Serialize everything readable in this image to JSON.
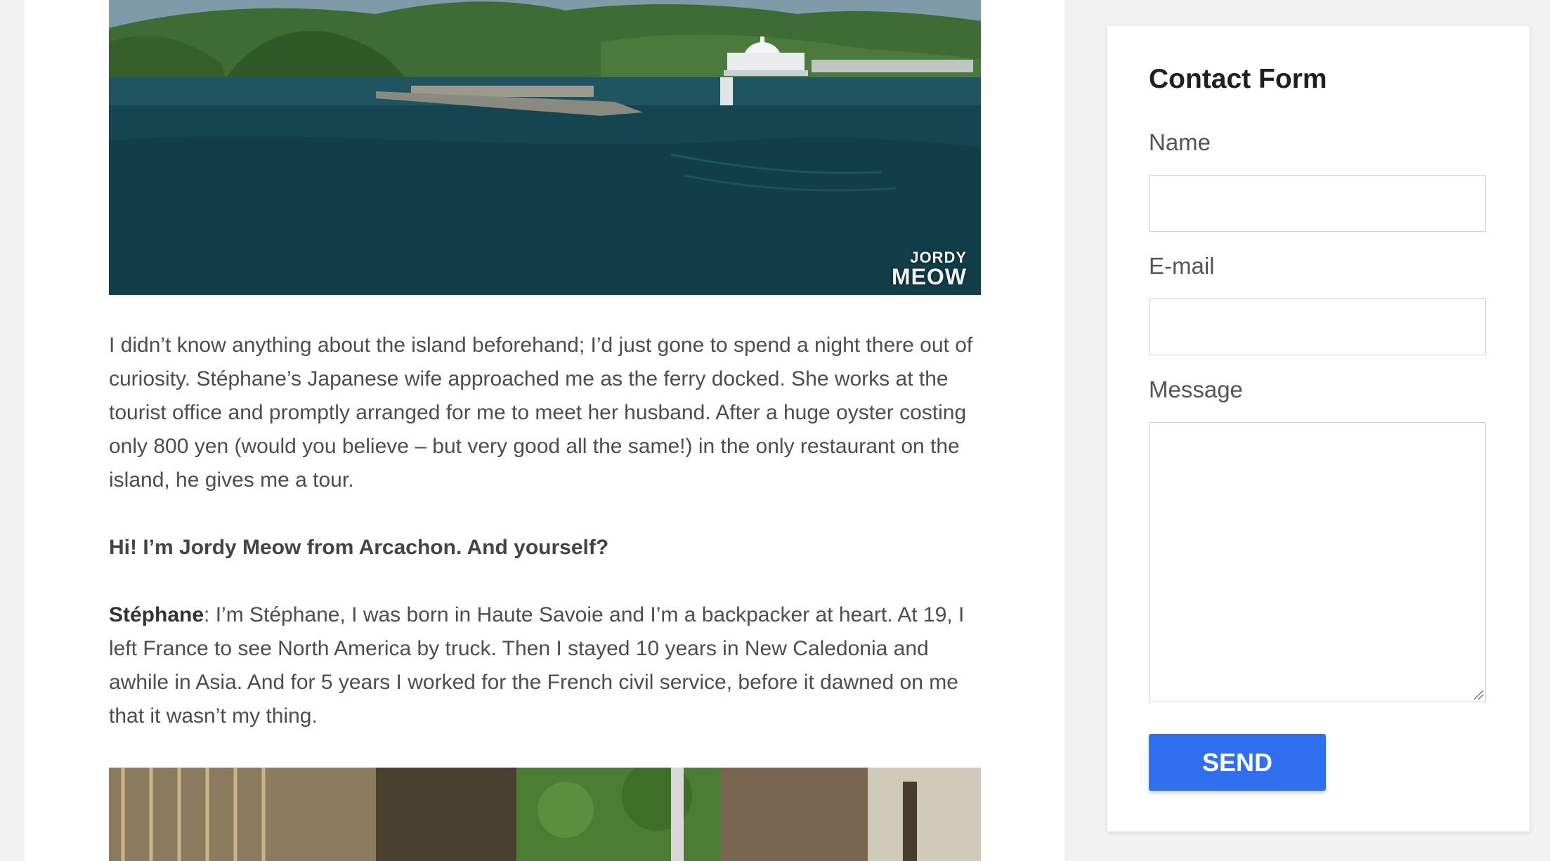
{
  "article": {
    "photo_top": {
      "watermark_line1": "JORDY",
      "watermark_line2": "MEOW"
    },
    "paragraph1": "I didn’t know anything about the island beforehand; I’d just gone to spend a night there out of curiosity. Stéphane’s Japanese wife approached me as the ferry docked. She works at the tourist office and promptly arranged for me to meet her husband. After a huge oyster costing only 800 yen (would you believe – but very good all the same!) in the only restaurant on the island, he gives me a tour.",
    "question": "Hi! I’m Jordy Meow from Arcachon. And yourself?",
    "answer_speaker": "Stéphane",
    "answer_text": ": I’m Stéphane, I was born in Haute Savoie and I’m a backpacker at heart. At 19, I left France to see North America by truck. Then I stayed 10 years in New Caledonia and awhile in Asia. And for 5 years I worked for the French civil service, before it dawned on me that it wasn’t my thing."
  },
  "contact_form": {
    "title": "Contact Form",
    "name_label": "Name",
    "name_value": "",
    "email_label": "E-mail",
    "email_value": "",
    "message_label": "Message",
    "message_value": "",
    "send_label": "SEND"
  },
  "colors": {
    "page_background": "#f2f2f2",
    "card_background": "#ffffff",
    "send_button": "#2f6ff0",
    "body_text": "#4d4d4d"
  }
}
